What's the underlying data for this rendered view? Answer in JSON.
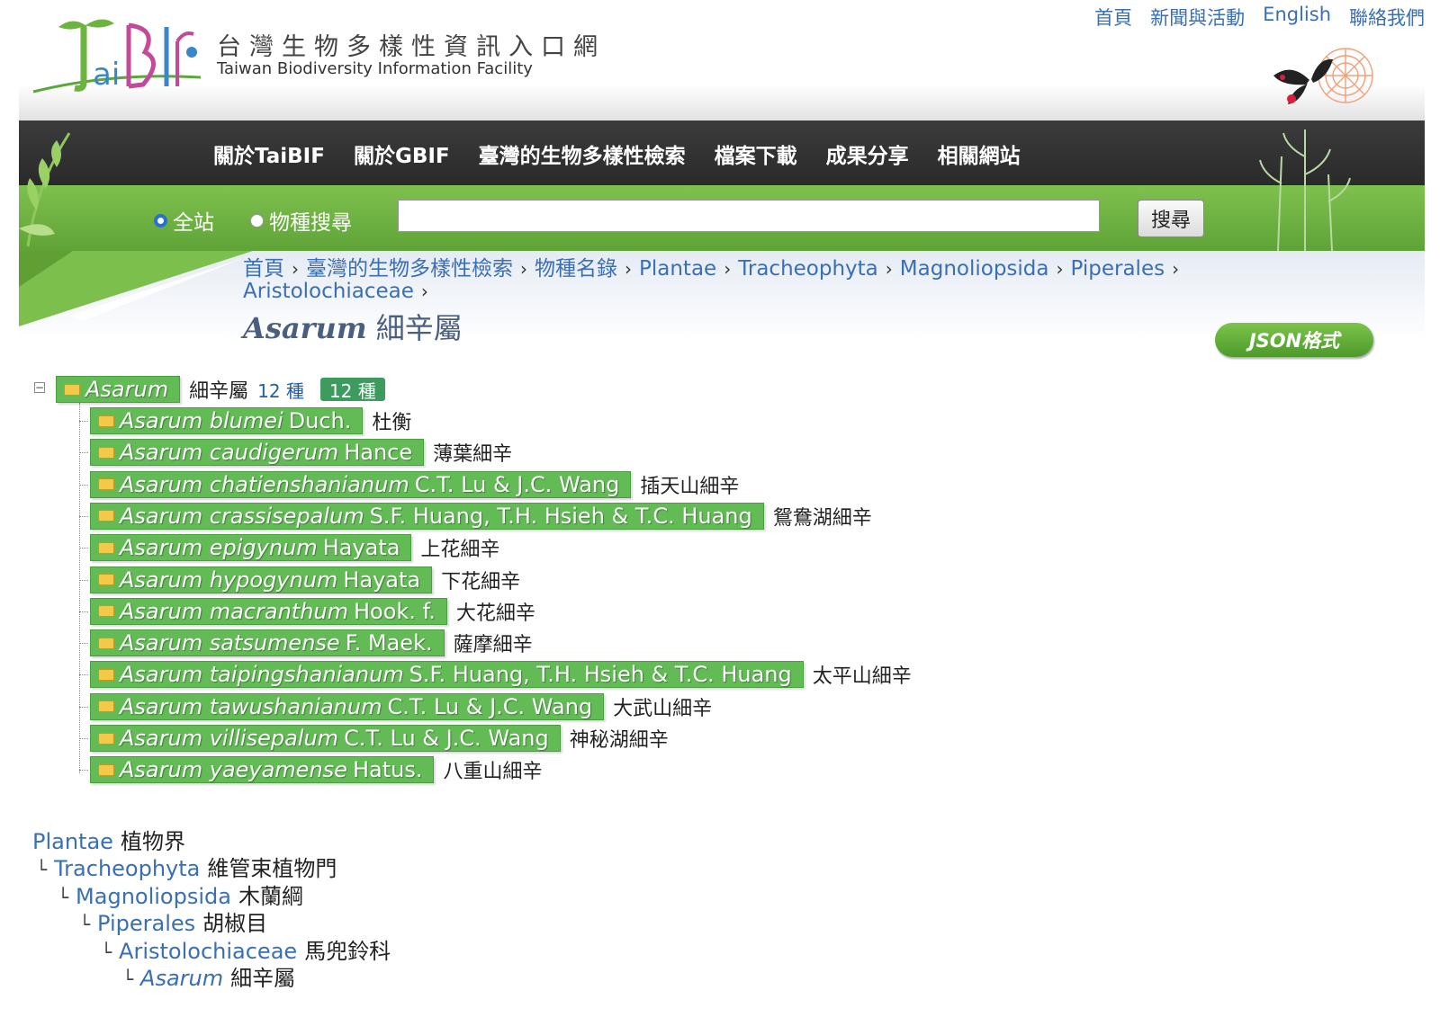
{
  "site": {
    "title_zh": "台灣生物多樣性資訊入口網",
    "title_en": "Taiwan Biodiversity Information Facility",
    "logo_text": "TaiBIF"
  },
  "top_links": [
    "首頁",
    "新聞與活動",
    "English",
    "聯絡我們"
  ],
  "nav": [
    "關於TaiBIF",
    "關於GBIF",
    "臺灣的生物多樣性檢索",
    "檔案下載",
    "成果分享",
    "相關網站"
  ],
  "search": {
    "options": [
      "全站",
      "物種搜尋"
    ],
    "selected": "全站",
    "value": "",
    "button": "搜尋"
  },
  "breadcrumb": [
    "首頁",
    "臺灣的生物多樣性檢索",
    "物種名錄",
    "Plantae",
    "Tracheophyta",
    "Magnoliopsida",
    "Piperales",
    "Aristolochiaceae"
  ],
  "page_title": {
    "sci": "Asarum",
    "zh": "細辛屬"
  },
  "json_button": "JSON格式",
  "tree": {
    "root": {
      "name": "Asarum",
      "zh": "細辛屬",
      "count_text": "12 種",
      "badge": "12 種"
    },
    "children": [
      {
        "sci": "Asarum blumei",
        "author": "Duch.",
        "zh": "杜衡"
      },
      {
        "sci": "Asarum caudigerum",
        "author": "Hance",
        "zh": "薄葉細辛"
      },
      {
        "sci": "Asarum chatienshanianum",
        "author": "C.T. Lu & J.C. Wang",
        "zh": "插天山細辛"
      },
      {
        "sci": "Asarum crassisepalum",
        "author": "S.F. Huang, T.H. Hsieh & T.C. Huang",
        "zh": "鴛鴦湖細辛"
      },
      {
        "sci": "Asarum epigynum",
        "author": "Hayata",
        "zh": "上花細辛"
      },
      {
        "sci": "Asarum hypogynum",
        "author": "Hayata",
        "zh": "下花細辛"
      },
      {
        "sci": "Asarum macranthum",
        "author": "Hook. f.",
        "zh": "大花細辛"
      },
      {
        "sci": "Asarum satsumense",
        "author": "F. Maek.",
        "zh": "薩摩細辛"
      },
      {
        "sci": "Asarum taipingshanianum",
        "author": "S.F. Huang, T.H. Hsieh & T.C. Huang",
        "zh": "太平山細辛"
      },
      {
        "sci": "Asarum tawushanianum",
        "author": "C.T. Lu & J.C. Wang",
        "zh": "大武山細辛"
      },
      {
        "sci": "Asarum villisepalum",
        "author": "C.T. Lu & J.C. Wang",
        "zh": "神秘湖細辛"
      },
      {
        "sci": "Asarum yaeyamense",
        "author": "Hatus.",
        "zh": "八重山細辛"
      }
    ]
  },
  "classification": [
    {
      "sci": "Plantae",
      "zh": "植物界"
    },
    {
      "sci": "Tracheophyta",
      "zh": "維管束植物門"
    },
    {
      "sci": "Magnoliopsida",
      "zh": "木蘭綱"
    },
    {
      "sci": "Piperales",
      "zh": "胡椒目"
    },
    {
      "sci": "Aristolochiaceae",
      "zh": "馬兜鈴科"
    },
    {
      "sci": "Asarum",
      "zh": "細辛屬"
    }
  ]
}
